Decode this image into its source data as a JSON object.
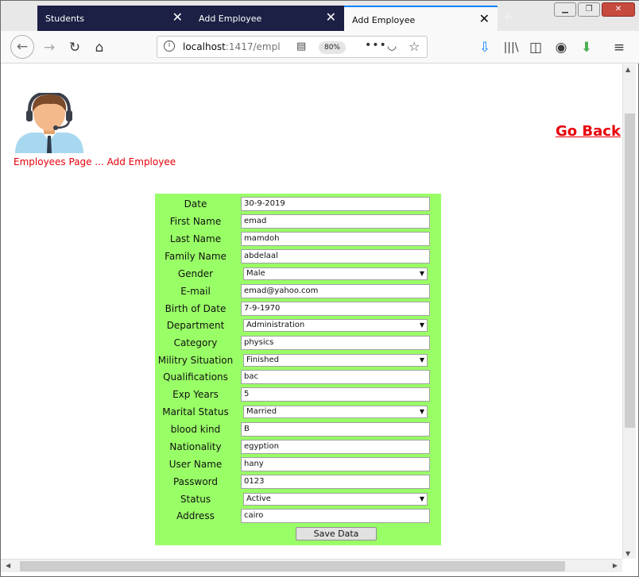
{
  "browser": {
    "tabs": [
      {
        "label": "Students"
      },
      {
        "label": "Add Employee"
      },
      {
        "label": "Add Employee"
      }
    ],
    "url_host": "localhost",
    "url_path": ":1417/empl",
    "zoom": "80%"
  },
  "page": {
    "go_back": "Go Back",
    "breadcrumb": "Employees Page ... Add Employee"
  },
  "form": {
    "fields": [
      {
        "label": "Date",
        "value": "30-9-2019",
        "type": "input"
      },
      {
        "label": "First Name",
        "value": "emad",
        "type": "input"
      },
      {
        "label": "Last Name",
        "value": "mamdoh",
        "type": "input"
      },
      {
        "label": "Family Name",
        "value": "abdelaal",
        "type": "input"
      },
      {
        "label": "Gender",
        "value": "Male",
        "type": "select"
      },
      {
        "label": "E-mail",
        "value": "emad@yahoo.com",
        "type": "input"
      },
      {
        "label": "Birth of Date",
        "value": "7-9-1970",
        "type": "input"
      },
      {
        "label": "Department",
        "value": "Administration",
        "type": "select"
      },
      {
        "label": "Category",
        "value": "physics",
        "type": "input"
      },
      {
        "label": "Militry Situation",
        "value": "Finished",
        "type": "select"
      },
      {
        "label": "Qualifications",
        "value": "bac",
        "type": "input"
      },
      {
        "label": "Exp Years",
        "value": "5",
        "type": "input"
      },
      {
        "label": "Marital Status",
        "value": "Married",
        "type": "select"
      },
      {
        "label": "blood kind",
        "value": "B",
        "type": "input"
      },
      {
        "label": "Nationality",
        "value": "egyption",
        "type": "input"
      },
      {
        "label": "User Name",
        "value": "hany",
        "type": "input"
      },
      {
        "label": "Password",
        "value": "0123",
        "type": "input"
      },
      {
        "label": "Status",
        "value": "Active",
        "type": "select"
      },
      {
        "label": "Address",
        "value": "cairo",
        "type": "input"
      }
    ],
    "save_label": "Save Data"
  },
  "colors": {
    "form_bg": "#99ff66",
    "link_red": "#e8000b",
    "tab_dark": "#1c2044"
  }
}
